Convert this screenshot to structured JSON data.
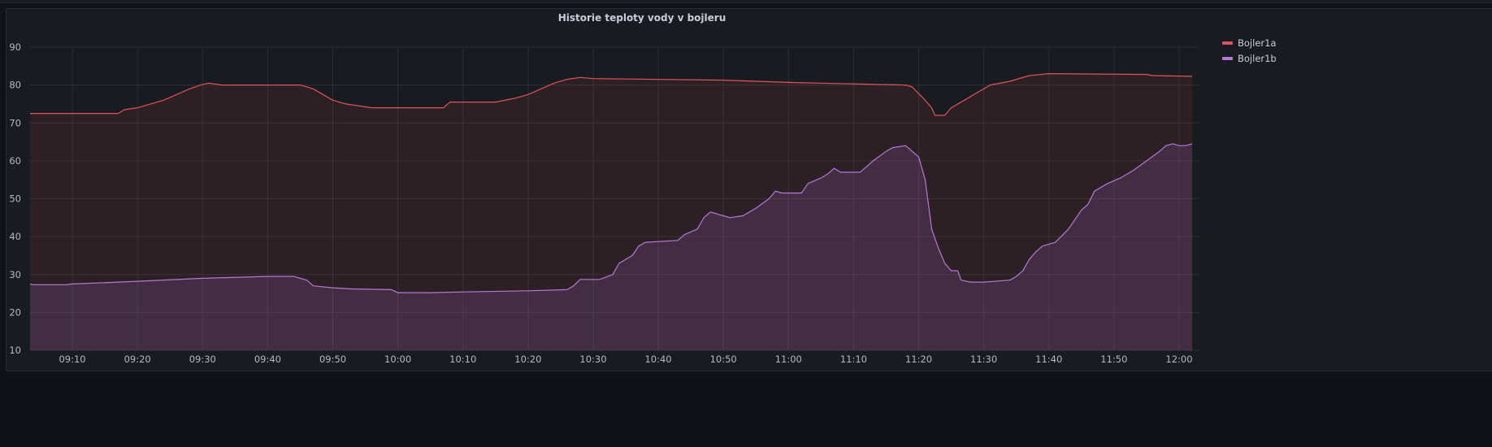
{
  "chart_data": {
    "type": "line",
    "title": "Historie teploty vody v bojleru",
    "xlabel": "",
    "ylabel": "",
    "ylim": [
      10,
      90
    ],
    "yticks": [
      "10",
      "20",
      "30",
      "40",
      "50",
      "60",
      "70",
      "80",
      "90"
    ],
    "xlim": [
      "09:03:30",
      "12:03:00"
    ],
    "xticks": [
      "09:10",
      "09:20",
      "09:30",
      "09:40",
      "09:50",
      "10:00",
      "10:10",
      "10:20",
      "10:30",
      "10:40",
      "10:50",
      "11:00",
      "11:10",
      "11:20",
      "11:30",
      "11:40",
      "11:50",
      "12:00"
    ],
    "grid": true,
    "legend": "right",
    "series": [
      {
        "name": "Bojler1a",
        "color": "#e0525e",
        "points": [
          [
            "09:03:30",
            72.5
          ],
          [
            "09:17",
            72.5
          ],
          [
            "09:18",
            73.5
          ],
          [
            "09:20",
            74
          ],
          [
            "09:22",
            75
          ],
          [
            "09:24",
            76
          ],
          [
            "09:26",
            77.5
          ],
          [
            "09:28",
            79
          ],
          [
            "09:30",
            80.2
          ],
          [
            "09:31",
            80.5
          ],
          [
            "09:33",
            80
          ],
          [
            "09:45",
            80
          ],
          [
            "09:47",
            79
          ],
          [
            "09:50",
            76
          ],
          [
            "09:52",
            75
          ],
          [
            "09:56",
            74
          ],
          [
            "10:07",
            74
          ],
          [
            "10:08",
            75.5
          ],
          [
            "10:15",
            75.5
          ],
          [
            "10:18",
            76.5
          ],
          [
            "10:20",
            77.5
          ],
          [
            "10:22",
            79
          ],
          [
            "10:24",
            80.5
          ],
          [
            "10:26",
            81.5
          ],
          [
            "10:28",
            82
          ],
          [
            "10:30",
            81.7
          ],
          [
            "10:50",
            81.3
          ],
          [
            "11:00",
            80.7
          ],
          [
            "11:18",
            80
          ],
          [
            "11:19",
            79.5
          ],
          [
            "11:21",
            76
          ],
          [
            "11:22",
            74
          ],
          [
            "11:22:30",
            72
          ],
          [
            "11:24",
            72
          ],
          [
            "11:25",
            74
          ],
          [
            "11:27",
            76
          ],
          [
            "11:29",
            78
          ],
          [
            "11:31",
            80
          ],
          [
            "11:34",
            81
          ],
          [
            "11:37",
            82.5
          ],
          [
            "11:40",
            83
          ],
          [
            "11:55",
            82.8
          ],
          [
            "11:56",
            82.5
          ],
          [
            "12:02",
            82.3
          ]
        ]
      },
      {
        "name": "Bojler1b",
        "color": "#b877d9",
        "points": [
          [
            "09:03:30",
            27.5
          ],
          [
            "09:04",
            27.3
          ],
          [
            "09:09",
            27.3
          ],
          [
            "09:10",
            27.5
          ],
          [
            "09:20",
            28.2
          ],
          [
            "09:30",
            29
          ],
          [
            "09:40",
            29.5
          ],
          [
            "09:44",
            29.5
          ],
          [
            "09:46",
            28.5
          ],
          [
            "09:47",
            27
          ],
          [
            "09:50",
            26.5
          ],
          [
            "09:53",
            26.2
          ],
          [
            "09:59",
            26
          ],
          [
            "10:00",
            25.2
          ],
          [
            "10:05",
            25.2
          ],
          [
            "10:10",
            25.4
          ],
          [
            "10:20",
            25.7
          ],
          [
            "10:26",
            26
          ],
          [
            "10:27",
            27
          ],
          [
            "10:28",
            28.7
          ],
          [
            "10:31",
            28.7
          ],
          [
            "10:33",
            30
          ],
          [
            "10:34",
            33
          ],
          [
            "10:36",
            35
          ],
          [
            "10:37",
            37.5
          ],
          [
            "10:38",
            38.5
          ],
          [
            "10:43",
            39
          ],
          [
            "10:44",
            40.5
          ],
          [
            "10:46",
            42
          ],
          [
            "10:47",
            45
          ],
          [
            "10:48",
            46.5
          ],
          [
            "10:50",
            45.5
          ],
          [
            "10:51",
            45
          ],
          [
            "10:53",
            45.5
          ],
          [
            "10:55",
            47.5
          ],
          [
            "10:57",
            50
          ],
          [
            "10:58",
            52
          ],
          [
            "10:59",
            51.5
          ],
          [
            "11:02",
            51.5
          ],
          [
            "11:03",
            54
          ],
          [
            "11:05",
            55.5
          ],
          [
            "11:06",
            56.5
          ],
          [
            "11:07",
            58
          ],
          [
            "11:08",
            57
          ],
          [
            "11:11",
            57
          ],
          [
            "11:13",
            60
          ],
          [
            "11:15",
            62.5
          ],
          [
            "11:16",
            63.5
          ],
          [
            "11:18",
            64
          ],
          [
            "11:19",
            62.5
          ],
          [
            "11:20",
            61
          ],
          [
            "11:21",
            55
          ],
          [
            "11:22",
            42
          ],
          [
            "11:23",
            37
          ],
          [
            "11:24",
            33
          ],
          [
            "11:25",
            31
          ],
          [
            "11:26",
            31
          ],
          [
            "11:26:30",
            28.5
          ],
          [
            "11:28",
            28
          ],
          [
            "11:30",
            28
          ],
          [
            "11:34",
            28.5
          ],
          [
            "11:35",
            29.5
          ],
          [
            "11:36",
            31
          ],
          [
            "11:37",
            34
          ],
          [
            "11:38",
            36
          ],
          [
            "11:39",
            37.5
          ],
          [
            "11:41",
            38.5
          ],
          [
            "11:43",
            42
          ],
          [
            "11:45",
            47
          ],
          [
            "11:46",
            48.5
          ],
          [
            "11:47",
            52
          ],
          [
            "11:49",
            54
          ],
          [
            "11:51",
            55.5
          ],
          [
            "11:53",
            57.5
          ],
          [
            "11:55",
            60
          ],
          [
            "11:57",
            62.5
          ],
          [
            "11:58",
            64
          ],
          [
            "11:59",
            64.5
          ],
          [
            "12:00",
            64
          ],
          [
            "12:01",
            64
          ],
          [
            "12:02",
            64.5
          ]
        ]
      }
    ]
  }
}
